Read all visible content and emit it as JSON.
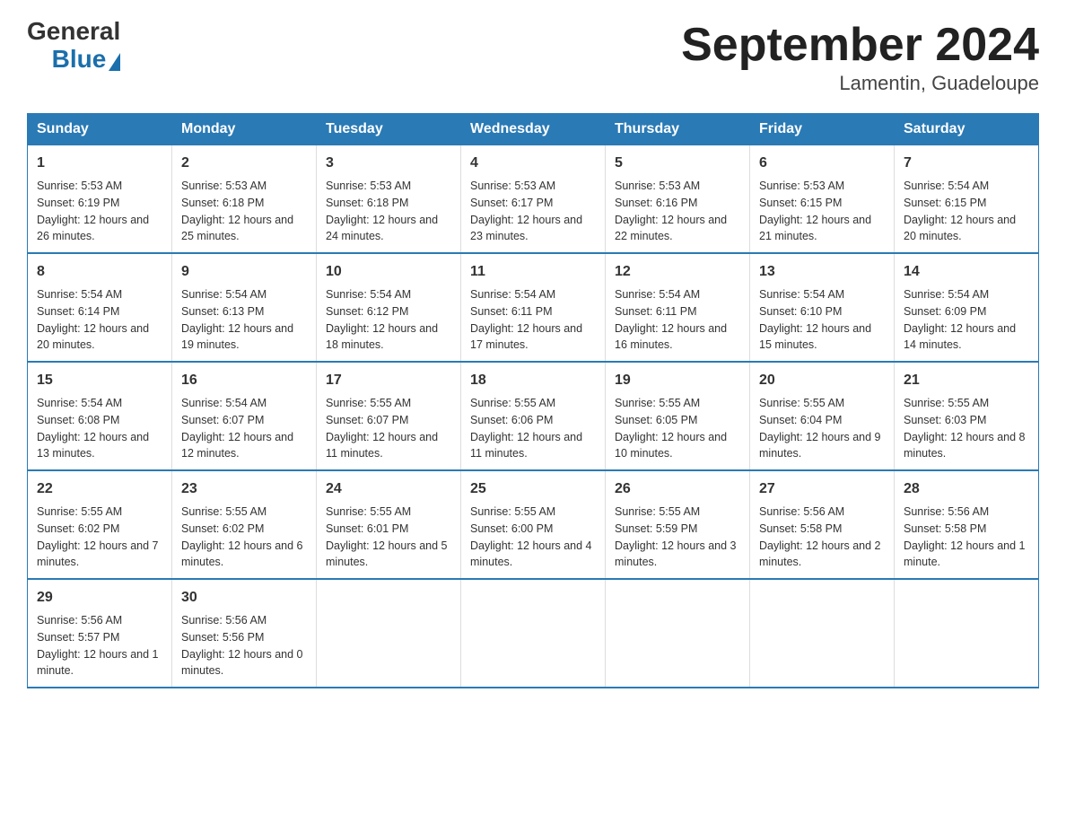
{
  "header": {
    "logo_general": "General",
    "logo_blue": "Blue",
    "title": "September 2024",
    "subtitle": "Lamentin, Guadeloupe"
  },
  "days_of_week": [
    "Sunday",
    "Monday",
    "Tuesday",
    "Wednesday",
    "Thursday",
    "Friday",
    "Saturday"
  ],
  "weeks": [
    [
      {
        "day": "1",
        "sunrise": "5:53 AM",
        "sunset": "6:19 PM",
        "daylight": "12 hours and 26 minutes."
      },
      {
        "day": "2",
        "sunrise": "5:53 AM",
        "sunset": "6:18 PM",
        "daylight": "12 hours and 25 minutes."
      },
      {
        "day": "3",
        "sunrise": "5:53 AM",
        "sunset": "6:18 PM",
        "daylight": "12 hours and 24 minutes."
      },
      {
        "day": "4",
        "sunrise": "5:53 AM",
        "sunset": "6:17 PM",
        "daylight": "12 hours and 23 minutes."
      },
      {
        "day": "5",
        "sunrise": "5:53 AM",
        "sunset": "6:16 PM",
        "daylight": "12 hours and 22 minutes."
      },
      {
        "day": "6",
        "sunrise": "5:53 AM",
        "sunset": "6:15 PM",
        "daylight": "12 hours and 21 minutes."
      },
      {
        "day": "7",
        "sunrise": "5:54 AM",
        "sunset": "6:15 PM",
        "daylight": "12 hours and 20 minutes."
      }
    ],
    [
      {
        "day": "8",
        "sunrise": "5:54 AM",
        "sunset": "6:14 PM",
        "daylight": "12 hours and 20 minutes."
      },
      {
        "day": "9",
        "sunrise": "5:54 AM",
        "sunset": "6:13 PM",
        "daylight": "12 hours and 19 minutes."
      },
      {
        "day": "10",
        "sunrise": "5:54 AM",
        "sunset": "6:12 PM",
        "daylight": "12 hours and 18 minutes."
      },
      {
        "day": "11",
        "sunrise": "5:54 AM",
        "sunset": "6:11 PM",
        "daylight": "12 hours and 17 minutes."
      },
      {
        "day": "12",
        "sunrise": "5:54 AM",
        "sunset": "6:11 PM",
        "daylight": "12 hours and 16 minutes."
      },
      {
        "day": "13",
        "sunrise": "5:54 AM",
        "sunset": "6:10 PM",
        "daylight": "12 hours and 15 minutes."
      },
      {
        "day": "14",
        "sunrise": "5:54 AM",
        "sunset": "6:09 PM",
        "daylight": "12 hours and 14 minutes."
      }
    ],
    [
      {
        "day": "15",
        "sunrise": "5:54 AM",
        "sunset": "6:08 PM",
        "daylight": "12 hours and 13 minutes."
      },
      {
        "day": "16",
        "sunrise": "5:54 AM",
        "sunset": "6:07 PM",
        "daylight": "12 hours and 12 minutes."
      },
      {
        "day": "17",
        "sunrise": "5:55 AM",
        "sunset": "6:07 PM",
        "daylight": "12 hours and 11 minutes."
      },
      {
        "day": "18",
        "sunrise": "5:55 AM",
        "sunset": "6:06 PM",
        "daylight": "12 hours and 11 minutes."
      },
      {
        "day": "19",
        "sunrise": "5:55 AM",
        "sunset": "6:05 PM",
        "daylight": "12 hours and 10 minutes."
      },
      {
        "day": "20",
        "sunrise": "5:55 AM",
        "sunset": "6:04 PM",
        "daylight": "12 hours and 9 minutes."
      },
      {
        "day": "21",
        "sunrise": "5:55 AM",
        "sunset": "6:03 PM",
        "daylight": "12 hours and 8 minutes."
      }
    ],
    [
      {
        "day": "22",
        "sunrise": "5:55 AM",
        "sunset": "6:02 PM",
        "daylight": "12 hours and 7 minutes."
      },
      {
        "day": "23",
        "sunrise": "5:55 AM",
        "sunset": "6:02 PM",
        "daylight": "12 hours and 6 minutes."
      },
      {
        "day": "24",
        "sunrise": "5:55 AM",
        "sunset": "6:01 PM",
        "daylight": "12 hours and 5 minutes."
      },
      {
        "day": "25",
        "sunrise": "5:55 AM",
        "sunset": "6:00 PM",
        "daylight": "12 hours and 4 minutes."
      },
      {
        "day": "26",
        "sunrise": "5:55 AM",
        "sunset": "5:59 PM",
        "daylight": "12 hours and 3 minutes."
      },
      {
        "day": "27",
        "sunrise": "5:56 AM",
        "sunset": "5:58 PM",
        "daylight": "12 hours and 2 minutes."
      },
      {
        "day": "28",
        "sunrise": "5:56 AM",
        "sunset": "5:58 PM",
        "daylight": "12 hours and 1 minute."
      }
    ],
    [
      {
        "day": "29",
        "sunrise": "5:56 AM",
        "sunset": "5:57 PM",
        "daylight": "12 hours and 1 minute."
      },
      {
        "day": "30",
        "sunrise": "5:56 AM",
        "sunset": "5:56 PM",
        "daylight": "12 hours and 0 minutes."
      },
      null,
      null,
      null,
      null,
      null
    ]
  ]
}
